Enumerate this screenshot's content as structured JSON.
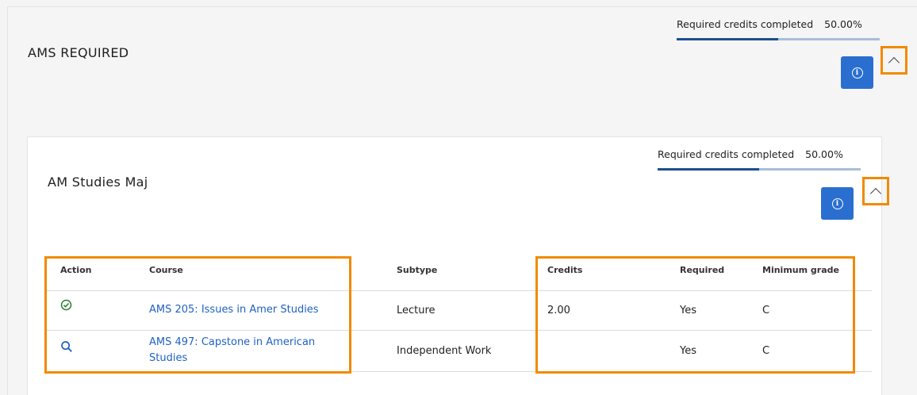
{
  "outer": {
    "title": "AMS REQUIRED",
    "progress_label": "Required credits completed",
    "progress_value": "50.00%",
    "progress_fraction": 0.5
  },
  "inner": {
    "title": "AM Studies Maj",
    "progress_label": "Required credits completed",
    "progress_value": "50.00%",
    "progress_fraction": 0.5
  },
  "table": {
    "headers": {
      "action": "Action",
      "course": "Course",
      "subtype": "Subtype",
      "credits": "Credits",
      "required": "Required",
      "min_grade": "Minimum grade"
    },
    "rows": [
      {
        "action_icon": "check-circle-icon",
        "course": "AMS 205: Issues in Amer Studies",
        "subtype": "Lecture",
        "credits": "2.00",
        "required": "Yes",
        "min_grade": "C"
      },
      {
        "action_icon": "search-icon",
        "course_line1": "AMS 497: Capstone in American",
        "course_line2": "Studies",
        "subtype": "Independent Work",
        "credits": "",
        "required": "Yes",
        "min_grade": "C"
      }
    ]
  },
  "colors": {
    "accent": "#2a6fd0",
    "highlight": "#f28a00",
    "link": "#1f61c2",
    "progress_fill": "#1d4e8f",
    "success": "#2e7d32"
  }
}
